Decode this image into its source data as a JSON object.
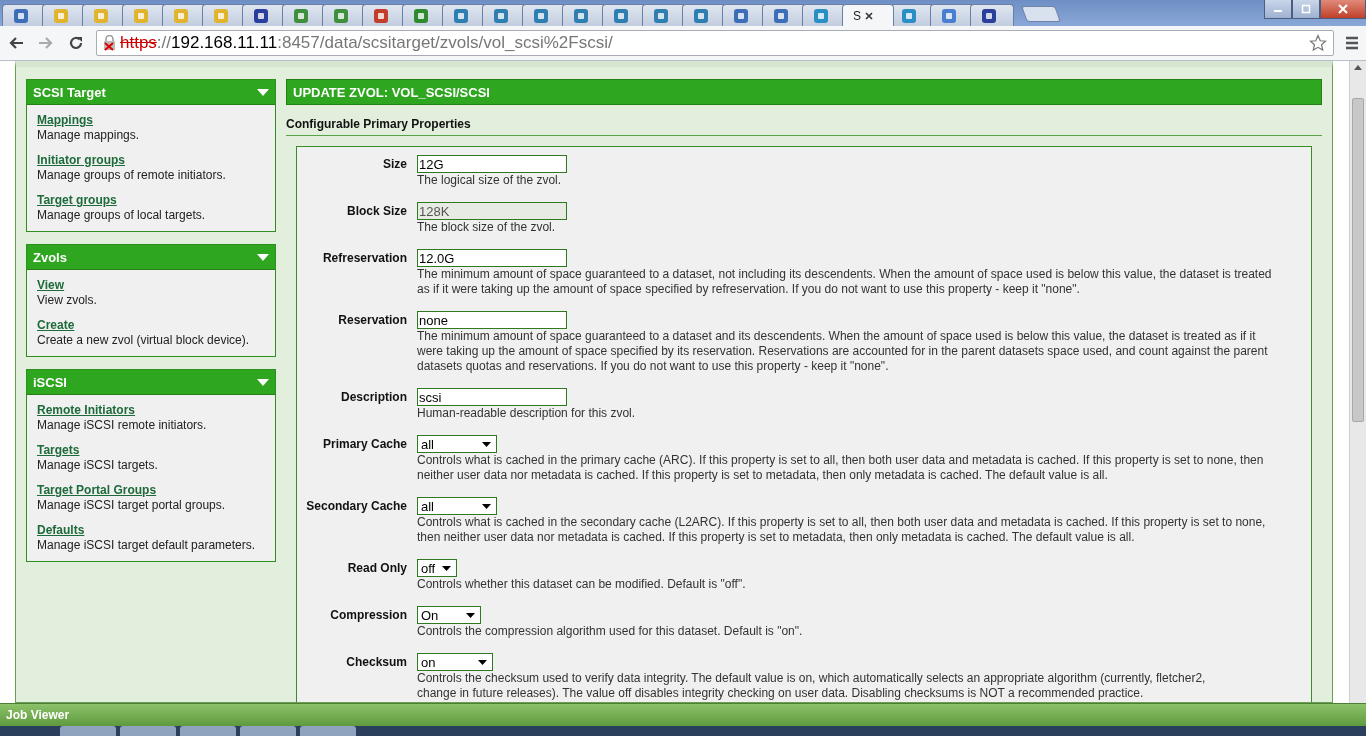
{
  "browser": {
    "tabs": [
      {
        "selected": false
      },
      {
        "selected": false
      },
      {
        "selected": false
      },
      {
        "selected": false
      },
      {
        "selected": false
      },
      {
        "selected": false
      },
      {
        "selected": false
      },
      {
        "selected": false
      },
      {
        "selected": false
      },
      {
        "selected": false
      },
      {
        "selected": false
      },
      {
        "selected": false
      },
      {
        "selected": false
      },
      {
        "selected": false
      },
      {
        "selected": false
      },
      {
        "selected": false
      },
      {
        "selected": false
      },
      {
        "selected": false
      },
      {
        "selected": false
      },
      {
        "selected": false
      },
      {
        "selected": false
      },
      {
        "label": "S",
        "selected": true
      },
      {
        "selected": false
      },
      {
        "selected": false
      },
      {
        "selected": false
      }
    ],
    "url": {
      "scheme": "https",
      "separator": "://",
      "host": "192.168.11.11",
      "rest": ":8457/data/scsitarget/zvols/vol_scsi%2Fscsi/"
    }
  },
  "sidebar": [
    {
      "title": "SCSI Target",
      "expanded": true,
      "items": [
        {
          "link": "Mappings",
          "text": "Manage mappings."
        },
        {
          "link": "Initiator groups",
          "text": "Manage groups of remote initiators."
        },
        {
          "link": "Target groups",
          "text": "Manage groups of local targets."
        }
      ]
    },
    {
      "title": "Zvols",
      "expanded": true,
      "items": [
        {
          "link": "View",
          "text": "View zvols."
        },
        {
          "link": "Create",
          "text": "Create a new zvol (virtual block device)."
        }
      ]
    },
    {
      "title": "iSCSI",
      "expanded": true,
      "items": [
        {
          "link": "Remote Initiators",
          "text": "Manage iSCSI remote initiators."
        },
        {
          "link": "Targets",
          "text": "Manage iSCSI targets."
        },
        {
          "link": "Target Portal Groups",
          "text": "Manage iSCSI target portal groups."
        },
        {
          "link": "Defaults",
          "text": "Manage iSCSI target default parameters."
        }
      ]
    }
  ],
  "main": {
    "title": "UPDATE ZVOL: VOL_SCSI/SCSI",
    "section": "Configurable Primary Properties",
    "fields": [
      {
        "label": "Size",
        "kind": "text",
        "value": "12G",
        "disabled": false,
        "help": [
          "The logical size of the zvol."
        ]
      },
      {
        "label": "Block Size",
        "kind": "text",
        "value": "128K",
        "disabled": true,
        "help": [
          "The block size of the zvol."
        ]
      },
      {
        "label": "Refreservation",
        "kind": "text",
        "value": "12.0G",
        "disabled": false,
        "help": [
          "The minimum amount of space guaranteed to a dataset, not including its descendents. When the amount of space used is below this value, the dataset is treated",
          "as if it were taking up the amount of space specified by refreservation. If you do not want to use this property - keep it \"none\"."
        ]
      },
      {
        "label": "Reservation",
        "kind": "text",
        "value": "none",
        "disabled": false,
        "help": [
          "The minimum amount of space guaranteed to a dataset and its descendents. When the amount of space used is below this value, the dataset is treated as if it",
          "were taking up the amount of space specified by its reservation. Reservations are accounted for in the parent datasets space used, and count against the parent",
          "datasets quotas and reservations. If you do not want to use this property - keep it \"none\"."
        ]
      },
      {
        "label": "Description",
        "kind": "text",
        "value": "scsi",
        "disabled": false,
        "help": [
          "Human-readable description for this zvol."
        ]
      },
      {
        "label": "Primary Cache",
        "kind": "select",
        "value": "all",
        "disabled": false,
        "help": [
          "Controls what is cached in the primary cache (ARC). If this property is set to all, then both user data and metadata is cached. If this property is set to none, then",
          "neither user data nor metadata is cached. If this property is set to metadata, then only metadata is cached. The default value is all."
        ]
      },
      {
        "label": "Secondary Cache",
        "kind": "select",
        "value": "all",
        "disabled": false,
        "help": [
          "Controls what is cached in the secondary cache (L2ARC). If this property is set to all, then both user data and metadata is cached. If this property is set to none,",
          "then neither user data nor metadata is cached. If this property is set to metadata, then only metadata is cached. The default value is all."
        ]
      },
      {
        "label": "Read Only",
        "kind": "select",
        "value": "off",
        "disabled": false,
        "help": [
          "Controls whether this dataset can be modified. Default is \"off\"."
        ]
      },
      {
        "label": "Compression",
        "kind": "select",
        "value": "On",
        "disabled": false,
        "help": [
          "Controls the compression algorithm used for this dataset. Default is \"on\"."
        ]
      },
      {
        "label": "Checksum",
        "kind": "select",
        "value": "on",
        "disabled": false,
        "help": [
          "Controls the checksum used to verify data integrity. The default value is on, which automatically selects an appropriate algorithm (currently, fletcher2,",
          "change in future releases). The value off disables integrity checking on user data. Disabling checksums is NOT a recommended practice."
        ]
      }
    ]
  },
  "job_viewer": {
    "title": "Job Viewer"
  }
}
